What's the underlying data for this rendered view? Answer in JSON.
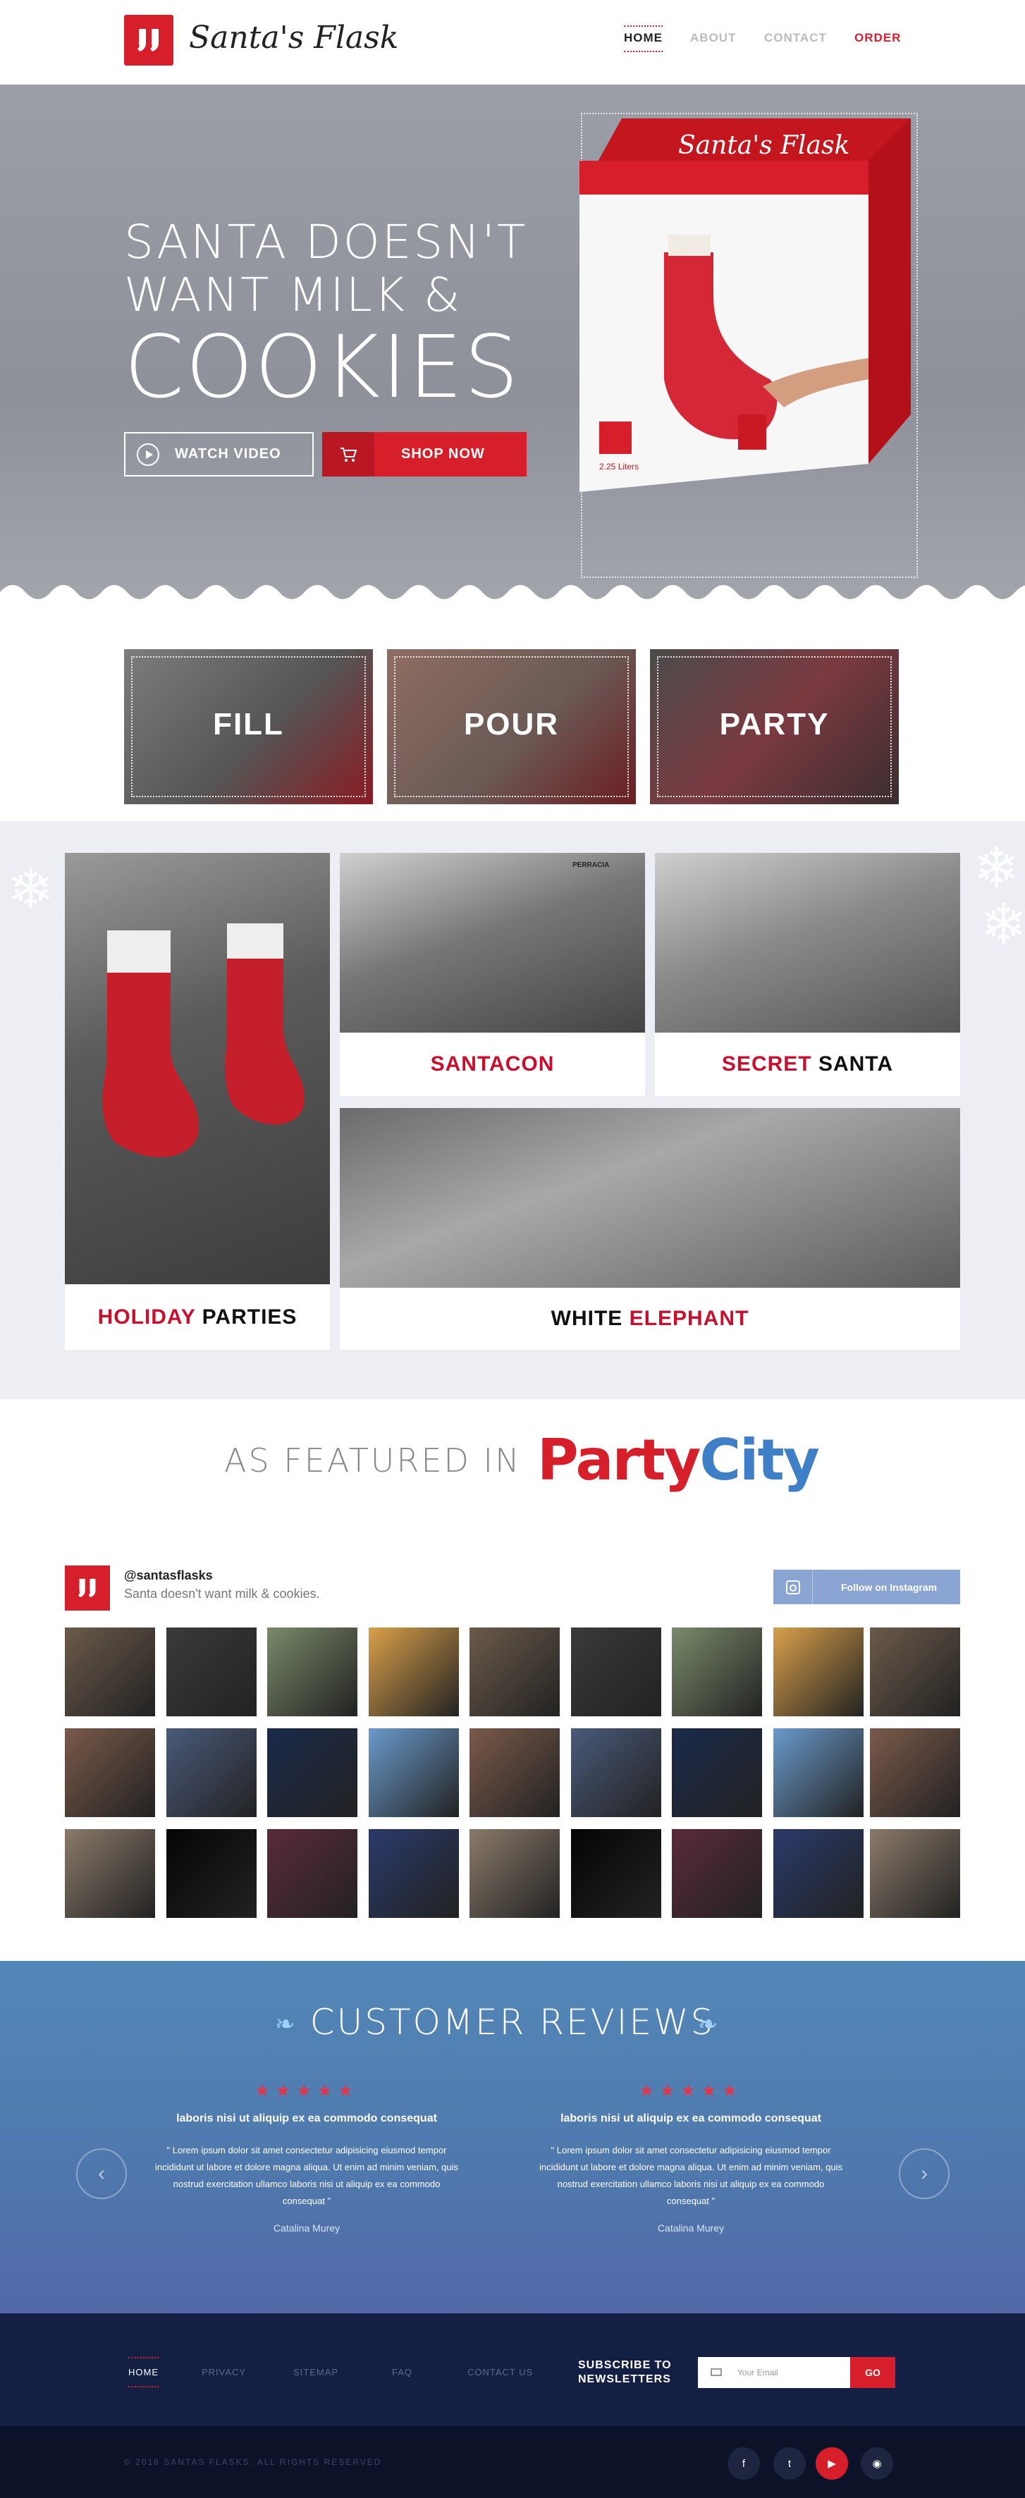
{
  "brand": {
    "name": "Santa's Flask"
  },
  "nav": {
    "home": "HOME",
    "about": "ABOUT",
    "contact": "CONTACT",
    "order": "ORDER"
  },
  "hero": {
    "line1": "SANTA DOESN'T",
    "line2": "WANT MILK &",
    "line3": "COOKIES",
    "watch_label": "WATCH VIDEO",
    "shop_label": "SHOP NOW",
    "box_brand": "Santa's Flask",
    "box_volume": "2.25 Liters"
  },
  "steps": [
    "FILL",
    "POUR",
    "PARTY"
  ],
  "gallery": {
    "santacon": "SANTACON",
    "secret_a": "SECRET",
    "secret_b": "SANTA",
    "holiday_a": "HOLIDAY",
    "holiday_b": "PARTIES",
    "white_a": "WHITE",
    "white_b": "ELEPHANT",
    "sign": "PERRACIA"
  },
  "featured": {
    "label": "AS FEATURED IN",
    "logo_a": "Party",
    "logo_b": "City"
  },
  "instagram": {
    "handle": "@santasflasks",
    "tagline": "Santa doesn't want milk & cookies.",
    "follow_label": "Follow on Instagram"
  },
  "reviews": {
    "title": "CUSTOMER REVIEWS",
    "items": [
      {
        "stars": "★★★★★",
        "headline": "laboris nisi ut aliquip ex ea commodo consequat",
        "body": "\" Lorem ipsum dolor sit amet consectetur adipisicing eiusmod tempor incididunt ut labore et dolore magna aliqua. Ut enim ad minim veniam, quis nostrud exercitation ullamco laboris nisi ut aliquip ex ea commodo consequat \"",
        "author": "Catalina Murey"
      },
      {
        "stars": "★★★★★",
        "headline": "laboris nisi ut aliquip ex ea commodo consequat",
        "body": "\" Lorem ipsum dolor sit amet consectetur adipisicing eiusmod tempor incididunt ut labore et dolore magna aliqua. Ut enim ad minim veniam, quis nostrud exercitation ullamco laboris nisi ut aliquip ex ea commodo consequat \"",
        "author": "Catalina Murey"
      }
    ],
    "prev": "‹",
    "next": "›"
  },
  "footer": {
    "links": [
      "HOME",
      "PRIVACY",
      "SITEMAP",
      "FAQ",
      "CONTACT US"
    ],
    "subscribe_1": "SUBSCRIBE TO",
    "subscribe_2": "NEWSLETTERS",
    "email_placeholder": "Your Email",
    "go_label": "GO",
    "copyright": "© 2016 SANTAS FLASKS. ALL RIGHTS RESERVED",
    "social": [
      "f",
      "t",
      "▶",
      "◉"
    ]
  },
  "colors": {
    "brand_red": "#d71f2c",
    "footer_navy": "#142043",
    "reviews_blue": "#5387b8",
    "follow_blue": "#8aa4d3"
  },
  "icons": [
    "stocking-logo-icon",
    "play-icon",
    "cart-icon",
    "instagram-icon",
    "envelope-icon",
    "facebook-icon",
    "twitter-icon",
    "youtube-icon",
    "rss-icon",
    "snowflake-icon"
  ]
}
